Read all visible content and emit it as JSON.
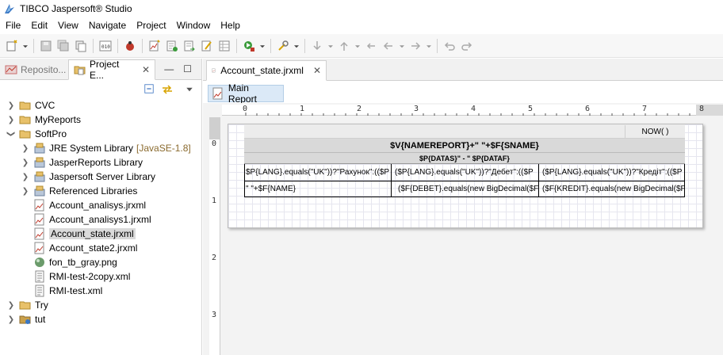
{
  "window": {
    "title": "TIBCO Jaspersoft® Studio"
  },
  "menu": [
    "File",
    "Edit",
    "View",
    "Navigate",
    "Project",
    "Window",
    "Help"
  ],
  "left_panel": {
    "tabs": [
      {
        "label": "Reposito...",
        "active": false
      },
      {
        "label": "Project E...",
        "active": true
      }
    ],
    "tree": [
      {
        "label": "CVC",
        "type": "project",
        "expanded": false,
        "depth": 0
      },
      {
        "label": "MyReports",
        "type": "project",
        "expanded": false,
        "depth": 0
      },
      {
        "label": "SoftPro",
        "type": "project",
        "expanded": true,
        "depth": 0
      },
      {
        "label": "JRE System Library",
        "decoration": "[JavaSE-1.8]",
        "type": "library",
        "expanded": false,
        "depth": 1
      },
      {
        "label": "JasperReports Library",
        "type": "library",
        "expanded": false,
        "depth": 1
      },
      {
        "label": "Jaspersoft Server Library",
        "type": "library",
        "expanded": false,
        "depth": 1
      },
      {
        "label": "Referenced Libraries",
        "type": "library",
        "expanded": false,
        "depth": 1
      },
      {
        "label": "Account_analisys.jrxml",
        "type": "jrxml",
        "depth": 1
      },
      {
        "label": "Account_analisys1.jrxml",
        "type": "jrxml",
        "depth": 1
      },
      {
        "label": "Account_state.jrxml",
        "type": "jrxml",
        "depth": 1,
        "selected": true
      },
      {
        "label": "Account_state2.jrxml",
        "type": "jrxml",
        "depth": 1
      },
      {
        "label": "fon_tb_gray.png",
        "type": "png",
        "depth": 1
      },
      {
        "label": "RMI-test-2copy.xml",
        "type": "xml",
        "depth": 1
      },
      {
        "label": "RMI-test.xml",
        "type": "xml",
        "depth": 1
      },
      {
        "label": "Try",
        "type": "project",
        "expanded": false,
        "depth": 0
      },
      {
        "label": "tut",
        "type": "project2",
        "expanded": false,
        "depth": 0
      }
    ]
  },
  "editor": {
    "tab_label": "Account_state.jrxml",
    "main_report_label": "Main Report",
    "ruler_h": [
      "0",
      "1",
      "2",
      "3",
      "4",
      "5",
      "6",
      "7",
      "8"
    ],
    "ruler_v": [
      "0",
      "1",
      "2",
      "3"
    ],
    "report": {
      "now_field": "NOW( )",
      "title_field": "$V{NAMEREPORT}+\" \"+$F{SNAME}",
      "dates_field": "$P{DATAS}\" - \" $P{DATAF}",
      "row1": [
        "$P{LANG}.equals(\"UK\"))?\"Рахунок\":(($P",
        "($P{LANG}.equals(\"UK\"))?\"Дебет\":(($P",
        "($P{LANG}.equals(\"UK\"))?\"Кредіт\":(($P"
      ],
      "row2": [
        "\" \"+$F{NAME}",
        "($F{DEBET}.equals(new BigDecimal($F",
        "($F{KREDIT}.equals(new BigDecimal($F"
      ]
    }
  }
}
